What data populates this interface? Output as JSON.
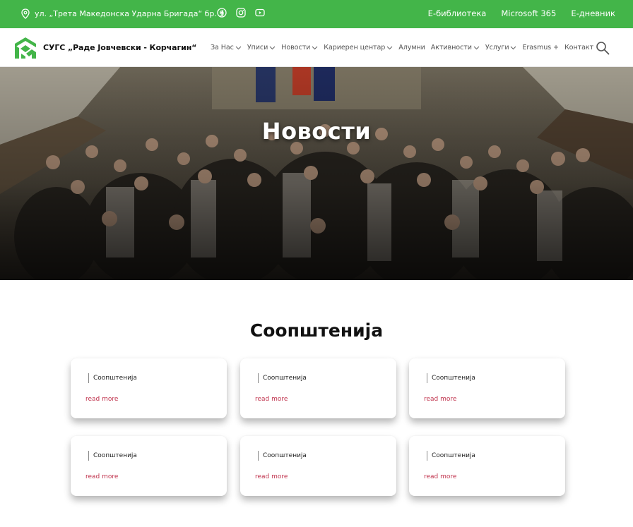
{
  "topbar": {
    "address": "ул. „Трета Македонска Ударна Бригада“ бр. 9",
    "socials": [
      {
        "icon": "facebook-icon"
      },
      {
        "icon": "instagram-icon"
      },
      {
        "icon": "youtube-icon"
      }
    ],
    "links": [
      "Е-библиотека",
      "Microsoft 365",
      "Е-дневник"
    ],
    "background_color": "#43b549"
  },
  "header": {
    "school_name": "СУГС „Раде Јовчевски - Корчагин“",
    "logo_color": "#43b549",
    "nav": [
      {
        "label": "За Нас",
        "dropdown": true
      },
      {
        "label": "Уписи",
        "dropdown": true
      },
      {
        "label": "Новости",
        "dropdown": true
      },
      {
        "label": "Кариерен центар",
        "dropdown": true
      },
      {
        "label": "Алумни",
        "dropdown": false
      },
      {
        "label": "Активности",
        "dropdown": true
      },
      {
        "label": "Услуги",
        "dropdown": true
      },
      {
        "label": "Erasmus +",
        "dropdown": false
      },
      {
        "label": "Контакт",
        "dropdown": false
      }
    ]
  },
  "hero": {
    "title": "Новости"
  },
  "section": {
    "title": "Соопштенија",
    "cards": [
      {
        "category": "Соопштенија",
        "link": "read more"
      },
      {
        "category": "Соопштенија",
        "link": "read more"
      },
      {
        "category": "Соопштенија",
        "link": "read more"
      },
      {
        "category": "Соопштенија",
        "link": "read more"
      },
      {
        "category": "Соопштенија",
        "link": "read more"
      },
      {
        "category": "Соопштенија",
        "link": "read more"
      }
    ],
    "link_color": "#c0334d"
  }
}
